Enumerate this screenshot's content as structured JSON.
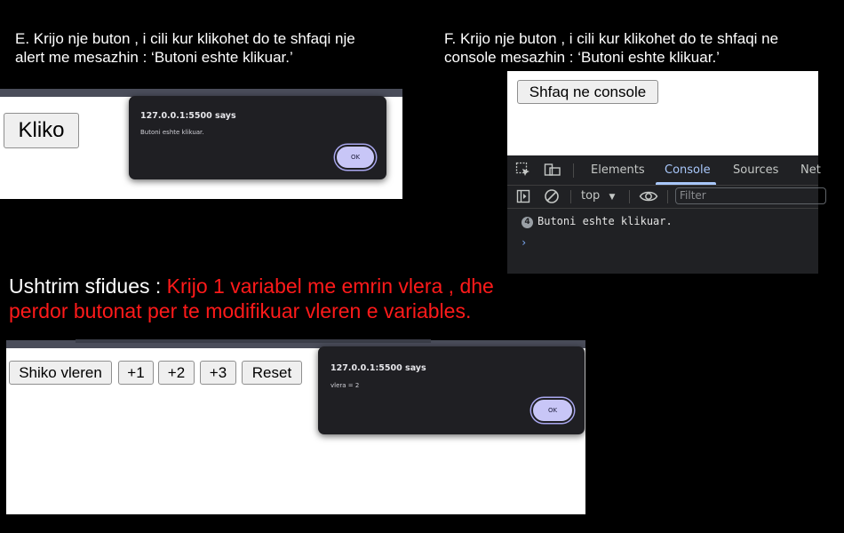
{
  "instructions": {
    "e_line1": "E. Krijo nje buton , i cili kur klikohet do te shfaqi nje",
    "e_line2": "alert me mesazhin : ‘Butoni eshte klikuar.’",
    "f_line1": "F. Krijo nje buton , i cili kur klikohet do te shfaqi ne",
    "f_line2": "console mesazhin : ‘Butoni eshte klikuar.’"
  },
  "challenge": {
    "label": "Ushtrim sfidues : ",
    "text_line1": "Krijo 1 variabel me emrin vlera , dhe",
    "text_line2": "perdor butonat per te modifikuar vleren e variables."
  },
  "panel_e": {
    "button_label": "Kliko",
    "dialog_title": "127.0.0.1:5500 says",
    "dialog_message": "Butoni eshte klikuar.",
    "ok_label": "OK"
  },
  "panel_f": {
    "button_label": "Shfaq ne console",
    "devtools": {
      "tabs": [
        "Elements",
        "Console",
        "Sources",
        "Net"
      ],
      "active_tab": "Console",
      "context": "top",
      "filter_placeholder": "Filter",
      "log_count": "4",
      "log_message": "Butoni eshte klikuar.",
      "prompt": "›"
    }
  },
  "panel_challenge": {
    "buttons": [
      "Shiko vleren",
      "+1",
      "+2",
      "+3",
      "Reset"
    ],
    "dialog_title": "127.0.0.1:5500 says",
    "dialog_message": "vlera = 2",
    "ok_label": "OK"
  },
  "colors": {
    "background": "#000000",
    "challenge_red": "#ff1a1a",
    "dialog_bg": "#1f1f23",
    "ok_button": "#c8c6f7",
    "devtools_bg": "#202124",
    "devtools_accent": "#a8c7fa"
  }
}
